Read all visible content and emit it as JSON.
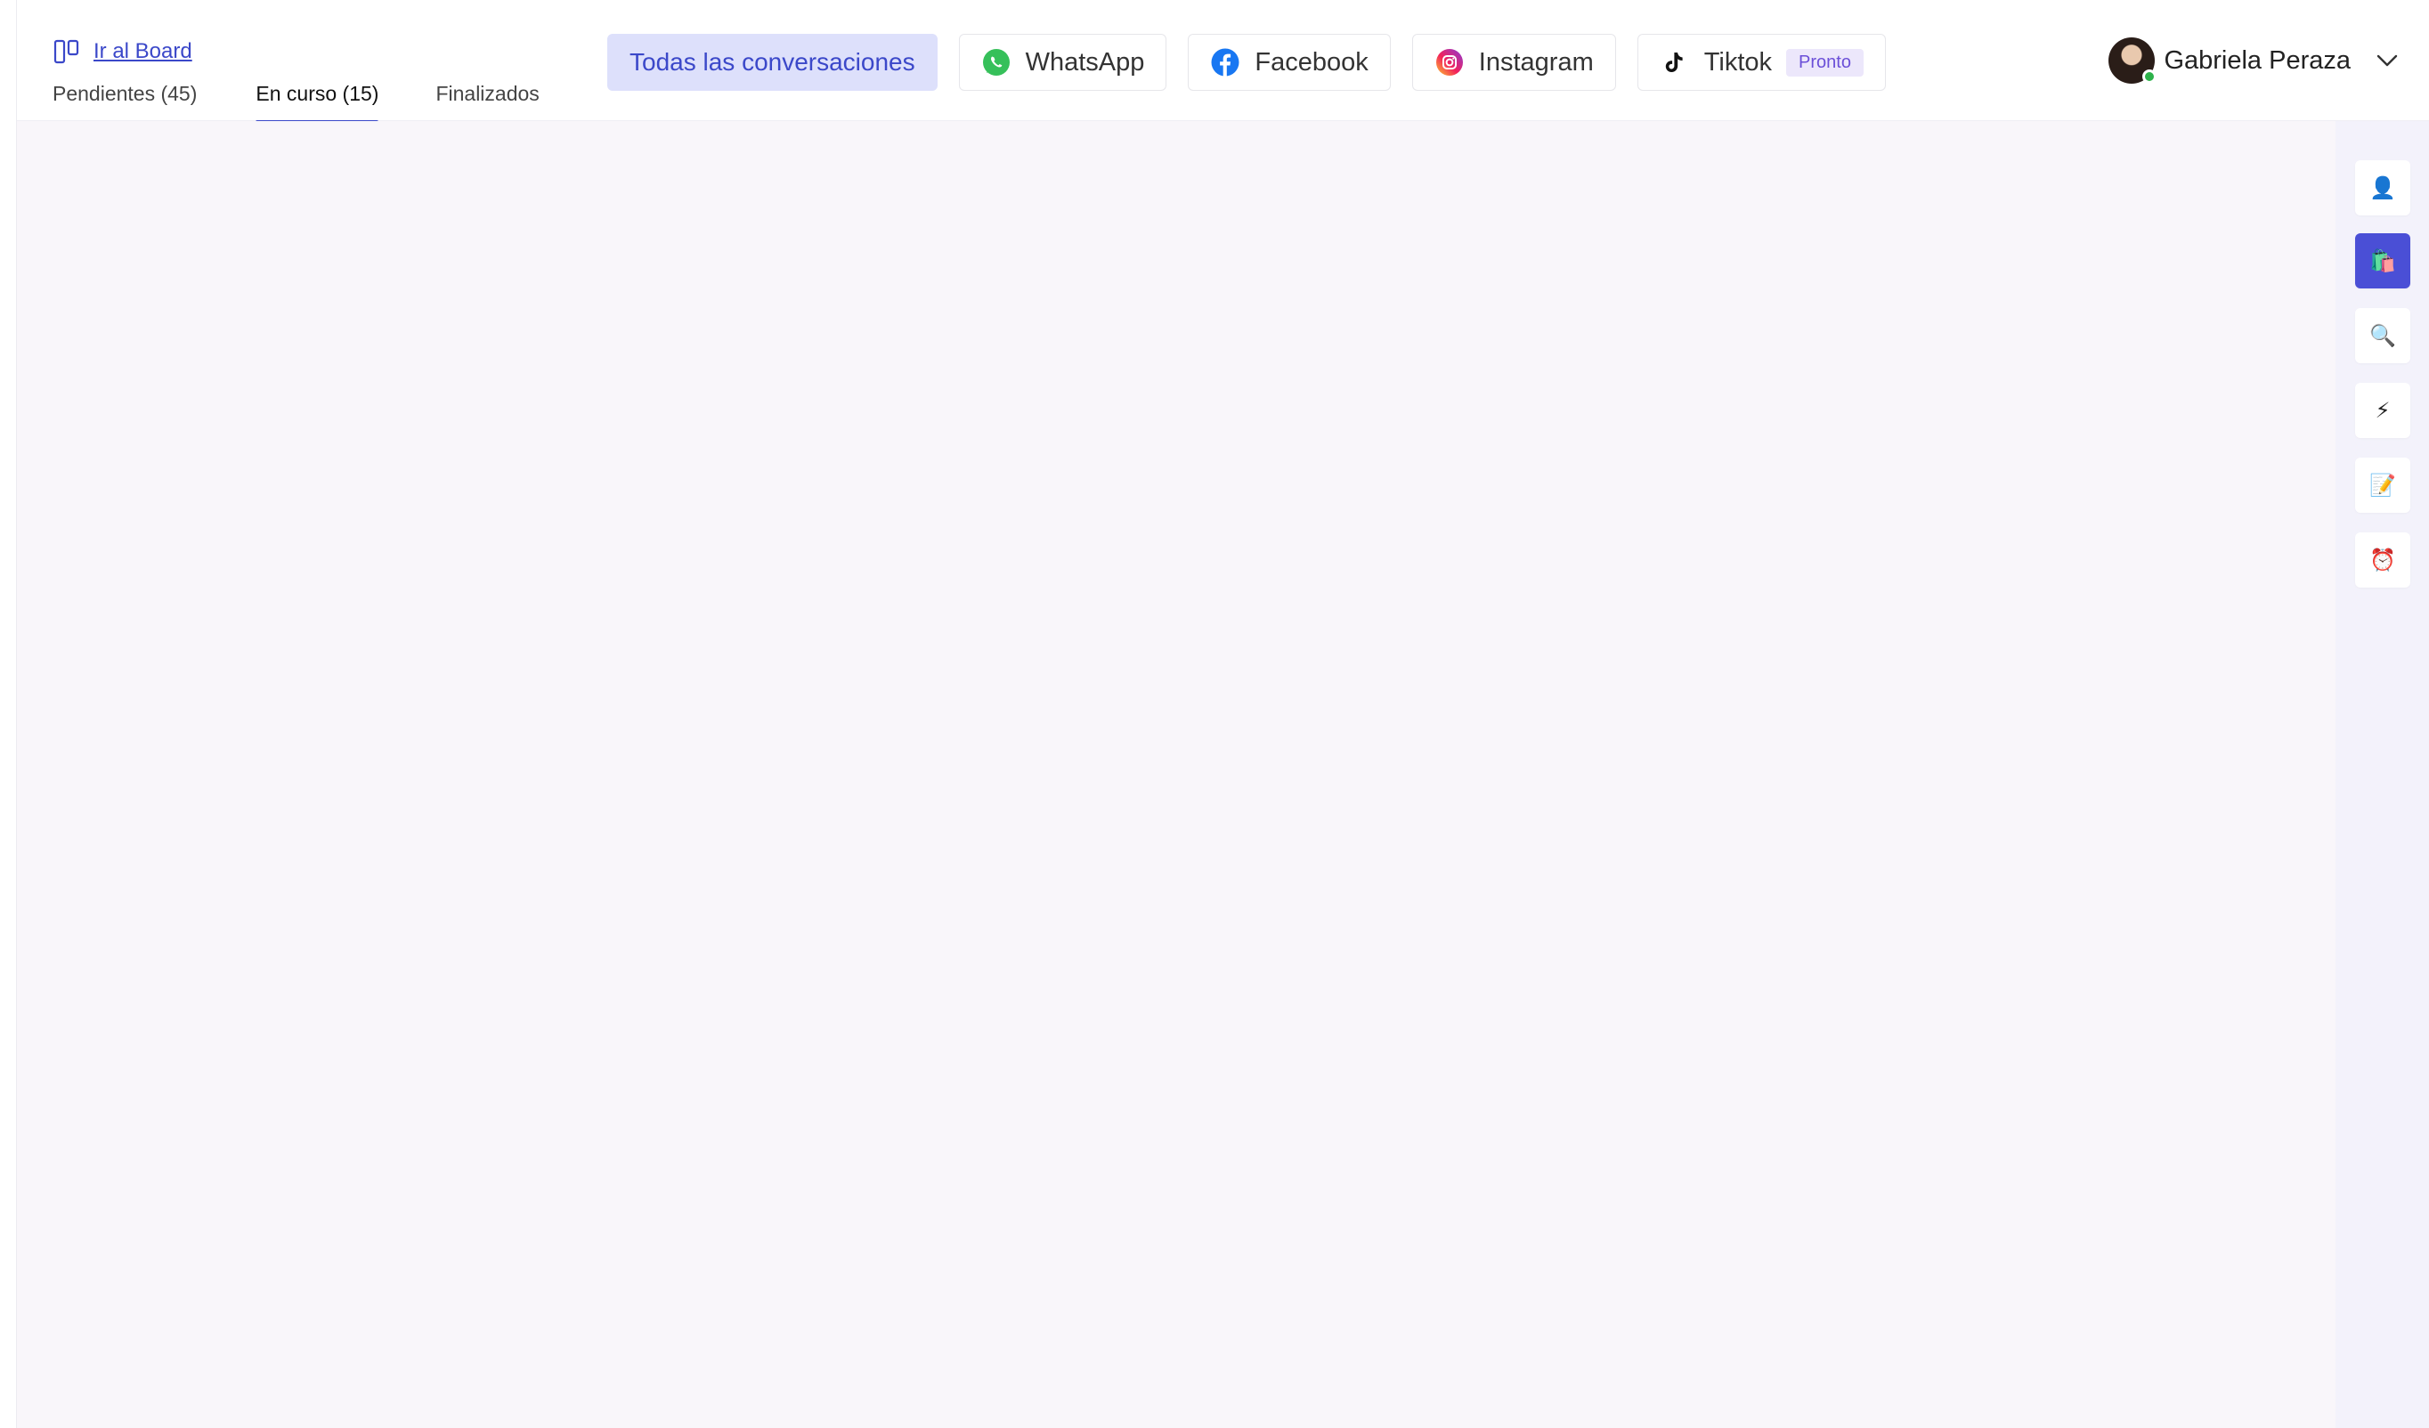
{
  "header": {
    "board_link": "Ir al Board",
    "status_tabs": [
      {
        "label": "Pendientes (45)"
      },
      {
        "label": "En curso (15)",
        "active": true
      },
      {
        "label": "Finalizados"
      }
    ],
    "channels": [
      {
        "label": "Todas las conversaciones",
        "active": true
      },
      {
        "label": "WhatsApp",
        "icon": "whatsapp-icon"
      },
      {
        "label": "Facebook",
        "icon": "facebook-icon"
      },
      {
        "label": "Instagram",
        "icon": "instagram-icon"
      },
      {
        "label": "Tiktok",
        "icon": "tiktok-icon",
        "badge": "Pronto"
      }
    ],
    "user": {
      "name": "Gabriela Peraza",
      "status": "online"
    }
  },
  "rail": {
    "buttons": [
      {
        "name": "contact",
        "glyph": "👤"
      },
      {
        "name": "shopping",
        "glyph": "🛍️",
        "active": true
      },
      {
        "name": "search",
        "glyph": "🔍"
      },
      {
        "name": "quick-replies",
        "glyph": "⚡"
      },
      {
        "name": "notes",
        "glyph": "📝"
      },
      {
        "name": "reminders",
        "glyph": "⏰"
      }
    ]
  },
  "colors": {
    "accent": "#3b48c9",
    "active_rail": "#4a4fd6",
    "main_bg": "#f9f6fa",
    "rail_bg": "#f3f2fb",
    "online": "#2db24a"
  }
}
